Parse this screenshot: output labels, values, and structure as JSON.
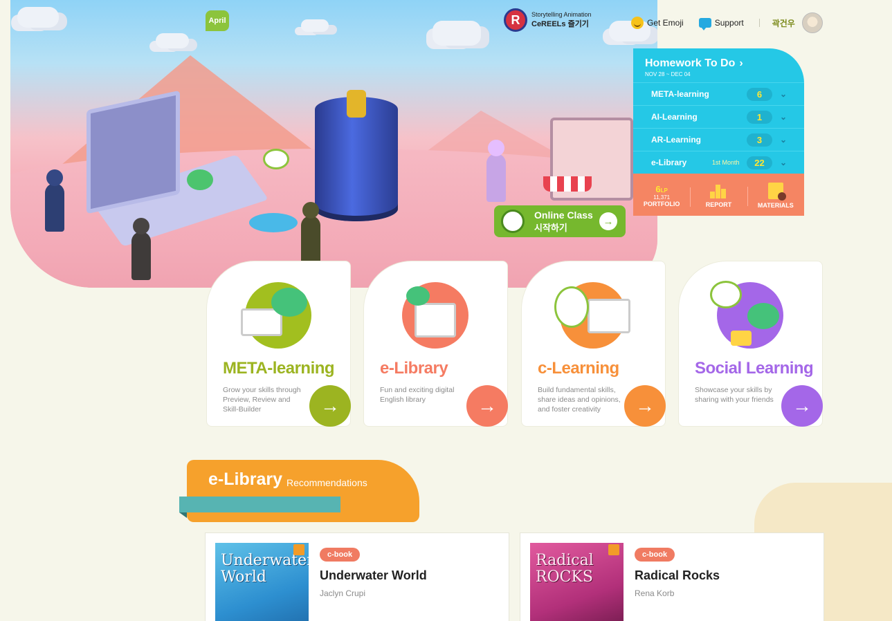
{
  "hero": {
    "april_badge": "April"
  },
  "topnav": {
    "cereels_line1": "Storytelling Animation",
    "cereels_line2": "CeREELs 즐기기",
    "get_emoji": "Get Emoji",
    "support": "Support",
    "username": "곽건우"
  },
  "homework": {
    "title": "Homework To Do",
    "date_range": "NOV 28 ~ DEC 04",
    "rows": [
      {
        "label": "META-learning",
        "sub": "",
        "count": "6"
      },
      {
        "label": "AI-Learning",
        "sub": "",
        "count": "1"
      },
      {
        "label": "AR-Learning",
        "sub": "",
        "count": "3"
      },
      {
        "label": "e-Library",
        "sub": "1st Month",
        "count": "22"
      }
    ],
    "footer": {
      "lp_value": "6",
      "lp_unit": "LP",
      "lp_number": "11,371",
      "portfolio": "PORTFOLIO",
      "report": "REPORT",
      "materials": "MATERIALS"
    }
  },
  "online_class": {
    "line1": "Online Class",
    "line2": "시작하기"
  },
  "cards": [
    {
      "title": "META-learning",
      "desc": "Grow your skills through Preview, Review and Skill-Builder",
      "color": "#9cb421"
    },
    {
      "title": "e-Library",
      "desc": "Fun and exciting digital English library",
      "color": "#f57b62"
    },
    {
      "title": "c-Learning",
      "desc": "Build fundamental skills, share ideas and opinions, and foster creativity",
      "color": "#f7903a"
    },
    {
      "title": "Social Learning",
      "desc": "Showcase your skills by sharing with your friends",
      "color": "#a467e8"
    }
  ],
  "recommendations": {
    "heading": "e-Library",
    "subheading": "Recommendations",
    "books": [
      {
        "badge": "c-book",
        "title": "Underwater World",
        "author": "Jaclyn Crupi",
        "cover_text": "Underwater World"
      },
      {
        "badge": "c-book",
        "title": "Radical Rocks",
        "author": "Rena Korb",
        "cover_text": "Radical ROCKS"
      }
    ]
  },
  "icons": {
    "arrow": "→",
    "chevron_right": "›",
    "chevron_down": "⌄"
  }
}
